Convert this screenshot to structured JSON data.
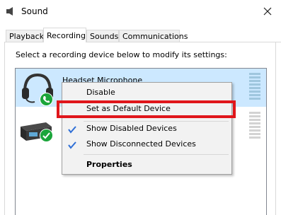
{
  "window": {
    "title": "Sound"
  },
  "tabs": [
    {
      "label": "Playback"
    },
    {
      "label": "Recording"
    },
    {
      "label": "Sounds"
    },
    {
      "label": "Communications"
    }
  ],
  "instruction": "Select a recording device below to modify its settings:",
  "devices": [
    {
      "name": "Headset Microphone",
      "icon": "headset-icon",
      "status": "phone-badge"
    },
    {
      "name": "",
      "icon": "microphone-device-icon",
      "status": "check-badge"
    }
  ],
  "context_menu": {
    "items": [
      {
        "label": "Disable",
        "checked": false
      },
      {
        "label": "Set as Default Device",
        "checked": false
      },
      {
        "label": "Show Disabled Devices",
        "checked": true
      },
      {
        "label": "Show Disconnected Devices",
        "checked": true
      },
      {
        "label": "Properties",
        "checked": false,
        "bold": true
      }
    ]
  },
  "colors": {
    "selection": "#cce8ff",
    "highlight_box": "#e0161b",
    "check_badge": "#1aa53a",
    "menu_check": "#2f6fd6"
  }
}
